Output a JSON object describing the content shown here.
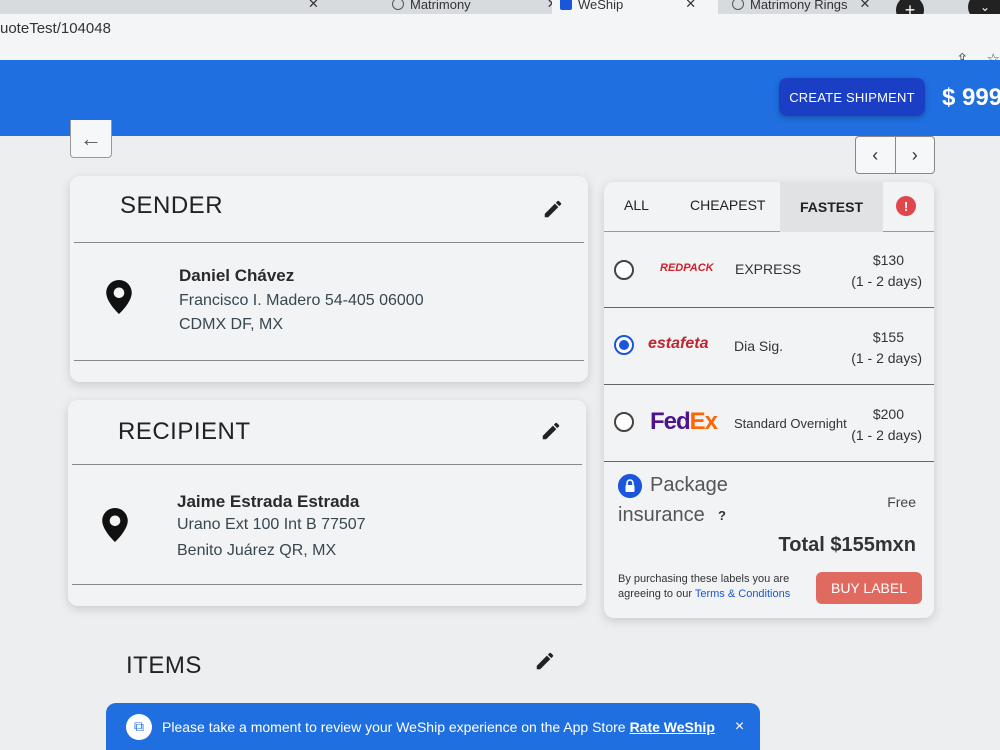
{
  "browser": {
    "tabs": [
      {
        "label": "Matrimony",
        "active": false
      },
      {
        "label": "WeShip",
        "active": true
      },
      {
        "label": "Matrimony Rings",
        "active": false
      }
    ],
    "url": "uoteTest/104048"
  },
  "header": {
    "create_shipment": "CREATE SHIPMENT",
    "balance": "$ 999"
  },
  "sender": {
    "title": "SENDER",
    "name": "Daniel Chávez",
    "address1": "Francisco I. Madero 54-405 06000",
    "address2": "CDMX DF, MX"
  },
  "recipient": {
    "title": "RECIPIENT",
    "name": "Jaime Estrada Estrada",
    "address1": "Urano Ext 100 Int B 77507",
    "address2": "Benito Juárez QR, MX"
  },
  "items": {
    "title": "ITEMS"
  },
  "rates": {
    "tabs": {
      "all": "ALL",
      "cheapest": "CHEAPEST",
      "fastest": "FASTEST"
    },
    "alert": "!",
    "options": [
      {
        "carrier": "REDPACK",
        "service": "EXPRESS",
        "price": "$130",
        "days": "(1 - 2 days)",
        "selected": false
      },
      {
        "carrier": "estafeta",
        "service": "Dia Sig.",
        "price": "$155",
        "days": "(1 - 2 days)",
        "selected": true
      },
      {
        "carrier_a": "Fed",
        "carrier_b": "Ex",
        "service": "Standard Overnight",
        "price": "$200",
        "days": "(1 - 2 days)",
        "selected": false
      }
    ],
    "insurance_line1": "Package",
    "insurance_line2": "insurance",
    "insurance_help": "?",
    "insurance_price": "Free",
    "total": "Total $155mxn",
    "terms_prefix": "By purchasing these labels you are agreeing to our",
    "terms_link": "Terms & Conditions",
    "buy_label": "BUY LABEL"
  },
  "banner": {
    "message": "Please take a moment to review your WeShip experience on the App Store",
    "link": "Rate WeShip",
    "close": "×"
  },
  "colors": {
    "brand_blue": "#1f6fe0",
    "buy_red": "#e06a5f",
    "redpack_red": "#d0212a",
    "fedex_purple": "#4d148c",
    "fedex_orange": "#ff6600"
  }
}
